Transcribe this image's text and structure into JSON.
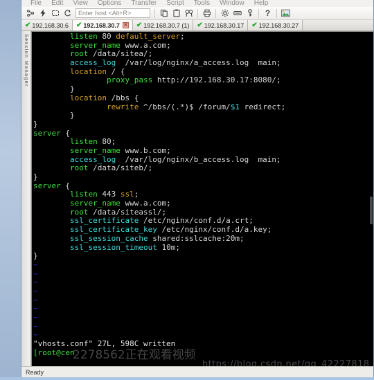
{
  "window": {
    "menu": [
      "File",
      "Edit",
      "View",
      "Options",
      "Transfer",
      "Script",
      "Tools",
      "Window",
      "Help"
    ],
    "status_text": "Ready"
  },
  "toolbar": {
    "host_placeholder": "Enter host <Alt+R>",
    "host_value": "",
    "buttons": [
      {
        "name": "connect-icon",
        "title": "Connect"
      },
      {
        "name": "quick-connect-icon",
        "title": "Quick Connect"
      },
      {
        "name": "connect-in-tab-icon",
        "title": "Connect in Tab"
      },
      {
        "name": "reconnect-icon",
        "title": "Reconnect"
      },
      {
        "name": "copy-icon",
        "title": "Copy"
      },
      {
        "name": "paste-icon",
        "title": "Paste"
      },
      {
        "name": "find-icon",
        "title": "Find"
      },
      {
        "name": "print-icon",
        "title": "Print"
      },
      {
        "name": "settings-icon",
        "title": "Session Options"
      },
      {
        "name": "keymap-icon",
        "title": "Keymap Editor"
      },
      {
        "name": "key-icon",
        "title": "Public Key"
      },
      {
        "name": "help-icon",
        "title": "Help"
      },
      {
        "name": "image-icon",
        "title": "Window Options"
      }
    ]
  },
  "tabs": [
    {
      "label": "192.168.30.6",
      "active": false,
      "closable": false
    },
    {
      "label": "192.168.30.7",
      "active": true,
      "closable": true
    },
    {
      "label": "192.168.30.7 (1)",
      "active": false,
      "closable": false
    },
    {
      "label": "192.168.30.17",
      "active": false,
      "closable": false
    },
    {
      "label": "192.168.30.27",
      "active": false,
      "closable": false
    }
  ],
  "sidebar": {
    "label": "Session Manager"
  },
  "terminal": {
    "lines": [
      [
        {
          "t": "        ",
          "c": "c-val"
        },
        {
          "t": "listen",
          "c": "c-key"
        },
        {
          "t": " 80 ",
          "c": "c-val"
        },
        {
          "t": "default_server",
          "c": "c-orange"
        },
        {
          "t": ";",
          "c": "c-val"
        }
      ],
      [
        {
          "t": "        ",
          "c": "c-val"
        },
        {
          "t": "server_name",
          "c": "c-key"
        },
        {
          "t": " www.a.com;",
          "c": "c-val"
        }
      ],
      [
        {
          "t": "        ",
          "c": "c-val"
        },
        {
          "t": "root",
          "c": "c-key"
        },
        {
          "t": " /data/sitea/;",
          "c": "c-val"
        }
      ],
      [
        {
          "t": "        ",
          "c": "c-val"
        },
        {
          "t": "access_log",
          "c": "c-cyan"
        },
        {
          "t": "  /var/log/nginx/a_access.log  main;",
          "c": "c-val"
        }
      ],
      [
        {
          "t": "        ",
          "c": "c-val"
        },
        {
          "t": "location",
          "c": "c-orange"
        },
        {
          "t": " / {",
          "c": "c-val"
        }
      ],
      [
        {
          "t": "                ",
          "c": "c-val"
        },
        {
          "t": "proxy_pass",
          "c": "c-key"
        },
        {
          "t": " http://192.168.30.17:8080/;",
          "c": "c-val"
        }
      ],
      [
        {
          "t": "        }",
          "c": "c-val"
        }
      ],
      [
        {
          "t": "        ",
          "c": "c-val"
        },
        {
          "t": "location",
          "c": "c-orange"
        },
        {
          "t": " /bbs {",
          "c": "c-val"
        }
      ],
      [
        {
          "t": "                ",
          "c": "c-val"
        },
        {
          "t": "rewrite",
          "c": "c-orange"
        },
        {
          "t": " ^/bbs/(.*)$ /forum/",
          "c": "c-val"
        },
        {
          "t": "$1",
          "c": "c-cyan"
        },
        {
          "t": " redirect;",
          "c": "c-val"
        }
      ],
      [
        {
          "t": "        }",
          "c": "c-val"
        }
      ],
      [
        {
          "t": "}",
          "c": "c-val"
        }
      ],
      [
        {
          "t": "server",
          "c": "c-key"
        },
        {
          "t": " {",
          "c": "c-val"
        }
      ],
      [
        {
          "t": "        ",
          "c": "c-val"
        },
        {
          "t": "listen",
          "c": "c-key"
        },
        {
          "t": " 80;",
          "c": "c-val"
        }
      ],
      [
        {
          "t": "        ",
          "c": "c-val"
        },
        {
          "t": "server_name",
          "c": "c-key"
        },
        {
          "t": " www.b.com;",
          "c": "c-val"
        }
      ],
      [
        {
          "t": "        ",
          "c": "c-val"
        },
        {
          "t": "access_log",
          "c": "c-cyan"
        },
        {
          "t": "  /var/log/nginx/b_access.log  main;",
          "c": "c-val"
        }
      ],
      [
        {
          "t": "        ",
          "c": "c-val"
        },
        {
          "t": "root",
          "c": "c-key"
        },
        {
          "t": " /data/siteb/;",
          "c": "c-val"
        }
      ],
      [
        {
          "t": "}",
          "c": "c-val"
        }
      ],
      [
        {
          "t": "server",
          "c": "c-key"
        },
        {
          "t": " {",
          "c": "c-val"
        }
      ],
      [
        {
          "t": "        ",
          "c": "c-val"
        },
        {
          "t": "listen",
          "c": "c-key"
        },
        {
          "t": " 443 ",
          "c": "c-val"
        },
        {
          "t": "ssl",
          "c": "c-orange"
        },
        {
          "t": ";",
          "c": "c-val"
        }
      ],
      [
        {
          "t": "        ",
          "c": "c-val"
        },
        {
          "t": "server_name",
          "c": "c-key"
        },
        {
          "t": " www.a.com;",
          "c": "c-val"
        }
      ],
      [
        {
          "t": "        ",
          "c": "c-val"
        },
        {
          "t": "root",
          "c": "c-key"
        },
        {
          "t": " /data/siteassl/;",
          "c": "c-val"
        }
      ],
      [
        {
          "t": "        ",
          "c": "c-val"
        },
        {
          "t": "ssl_certificate",
          "c": "c-cyan"
        },
        {
          "t": " /etc/nginx/conf.d/a.crt;",
          "c": "c-val"
        }
      ],
      [
        {
          "t": "        ",
          "c": "c-val"
        },
        {
          "t": "ssl_certificate_key",
          "c": "c-cyan"
        },
        {
          "t": " /etc/nginx/conf.d/a.key;",
          "c": "c-val"
        }
      ],
      [
        {
          "t": "        ",
          "c": "c-val"
        },
        {
          "t": "ssl_session_cache",
          "c": "c-cyan"
        },
        {
          "t": " shared:sslcache:20m;",
          "c": "c-val"
        }
      ],
      [
        {
          "t": "        ",
          "c": "c-val"
        },
        {
          "t": "ssl_session_timeout",
          "c": "c-cyan"
        },
        {
          "t": " 10m;",
          "c": "c-val"
        }
      ],
      [
        {
          "t": "}",
          "c": "c-val"
        }
      ],
      [
        {
          "t": "~",
          "c": "c-tilde"
        }
      ],
      [
        {
          "t": "~",
          "c": "c-tilde"
        }
      ],
      [
        {
          "t": "~",
          "c": "c-tilde"
        }
      ],
      [
        {
          "t": "~",
          "c": "c-tilde"
        }
      ],
      [
        {
          "t": "~",
          "c": "c-tilde"
        }
      ],
      [
        {
          "t": "~",
          "c": "c-tilde"
        }
      ],
      [
        {
          "t": "~",
          "c": "c-tilde"
        }
      ],
      [
        {
          "t": "~",
          "c": "c-tilde"
        }
      ],
      [
        {
          "t": "~",
          "c": "c-tilde"
        }
      ]
    ],
    "written_message": "\"vhosts.conf\" 27L, 598C written",
    "prompt": "[root@cen"
  },
  "watermarks": {
    "chinese": "2278562正在观看视频",
    "url": "https://blog.csdn.net/qq_42227818"
  }
}
